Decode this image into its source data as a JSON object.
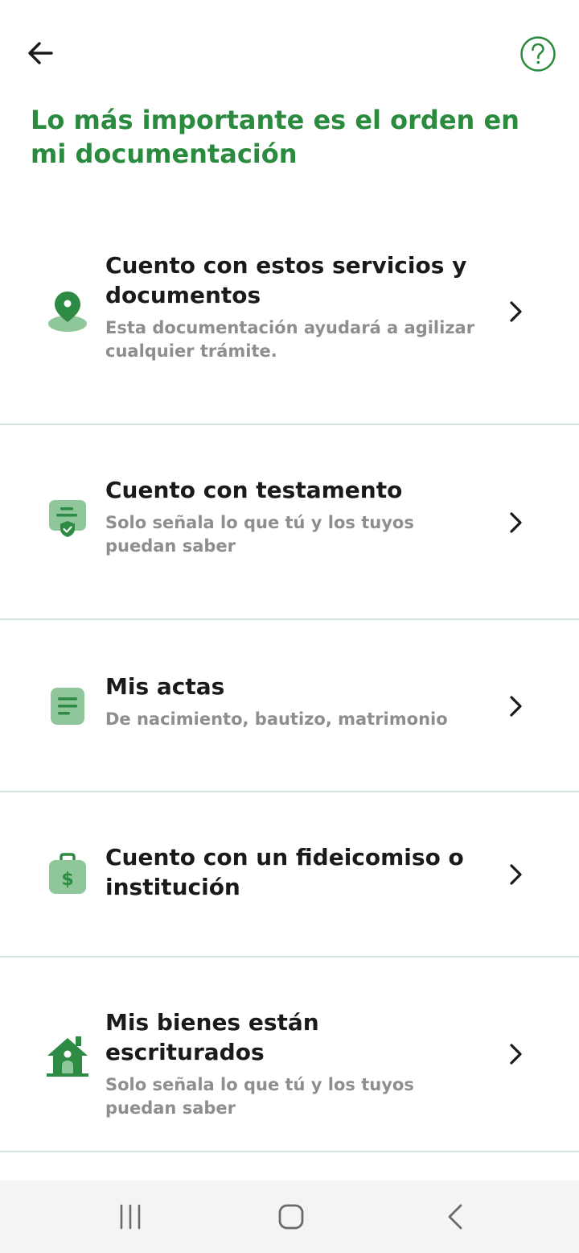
{
  "header": {
    "back_icon": "arrow-left-icon",
    "help_icon": "question-circle-icon",
    "title": "Lo más importante es el orden en mi documentación"
  },
  "items": [
    {
      "icon": "location-pin-icon",
      "title": "Cuento con estos servicios y documentos",
      "subtitle": "Esta documentación ayudará a agilizar cualquier trámite."
    },
    {
      "icon": "document-shield-icon",
      "title": "Cuento con testamento",
      "subtitle": "Solo señala lo que tú y los tuyos puedan saber"
    },
    {
      "icon": "document-lines-icon",
      "title": "Mis actas",
      "subtitle": "De nacimiento,  bautizo, matrimonio"
    },
    {
      "icon": "money-bag-icon",
      "title": "Cuento con un fideicomiso o institución",
      "subtitle": ""
    },
    {
      "icon": "house-icon",
      "title": "Mis bienes están escriturados",
      "subtitle": "Solo señala lo que tú y los tuyos puedan saber"
    }
  ],
  "colors": {
    "accent": "#2a8a3e",
    "icon_light": "#8fc69a",
    "icon_dark": "#2e8b44",
    "divider": "#d6e2dc"
  },
  "system_nav": {
    "recents_icon": "recents-icon",
    "home_icon": "home-icon",
    "back_icon": "nav-back-icon"
  }
}
